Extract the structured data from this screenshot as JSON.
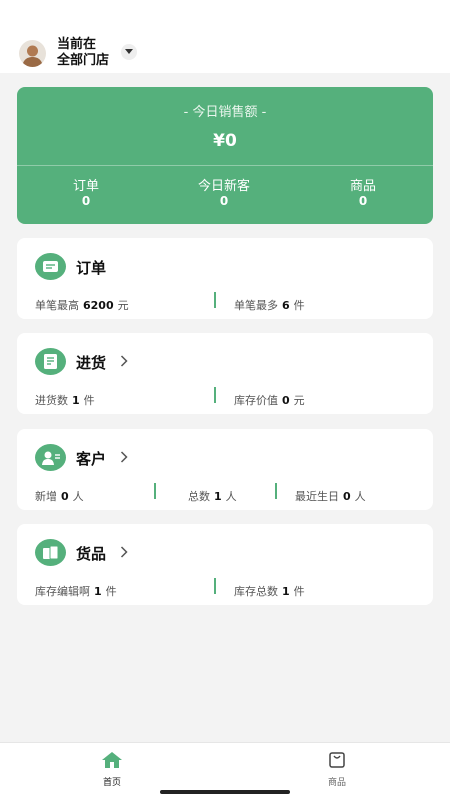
{
  "header": {
    "store_line1": "当前在",
    "store_line2": "全部门店"
  },
  "sales": {
    "label": "- 今日销售额 -",
    "amount": "¥0",
    "stats": [
      {
        "label": "订单",
        "value": "0"
      },
      {
        "label": "今日新客",
        "value": "0"
      },
      {
        "label": "商品",
        "value": "0"
      }
    ]
  },
  "cards": {
    "orders": {
      "title": "订单",
      "left_label": "单笔最高",
      "left_value": "6200",
      "left_unit": "元",
      "right_label": "单笔最多",
      "right_value": "6",
      "right_unit": "件"
    },
    "purchase": {
      "title": "进货",
      "left_label": "进货数",
      "left_value": "1",
      "left_unit": "件",
      "right_label": "库存价值",
      "right_value": "0",
      "right_unit": "元"
    },
    "customers": {
      "title": "客户",
      "c1_label": "新增",
      "c1_value": "0",
      "c1_unit": "人",
      "c2_label": "总数",
      "c2_value": "1",
      "c2_unit": "人",
      "c3_label": "最近生日",
      "c3_value": "0",
      "c3_unit": "人"
    },
    "goods": {
      "title": "货品",
      "left_label": "库存编辑啊",
      "left_value": "1",
      "left_unit": "件",
      "right_label": "库存总数",
      "right_value": "1",
      "right_unit": "件"
    }
  },
  "tabbar": {
    "home": {
      "label": "首页",
      "icon": "home-icon",
      "color": "#55b07c"
    },
    "goods": {
      "label": "商品",
      "icon": "bag-icon",
      "color": "#666666"
    }
  },
  "colors": {
    "accent": "#55b07c",
    "background": "#f3f3f3"
  }
}
